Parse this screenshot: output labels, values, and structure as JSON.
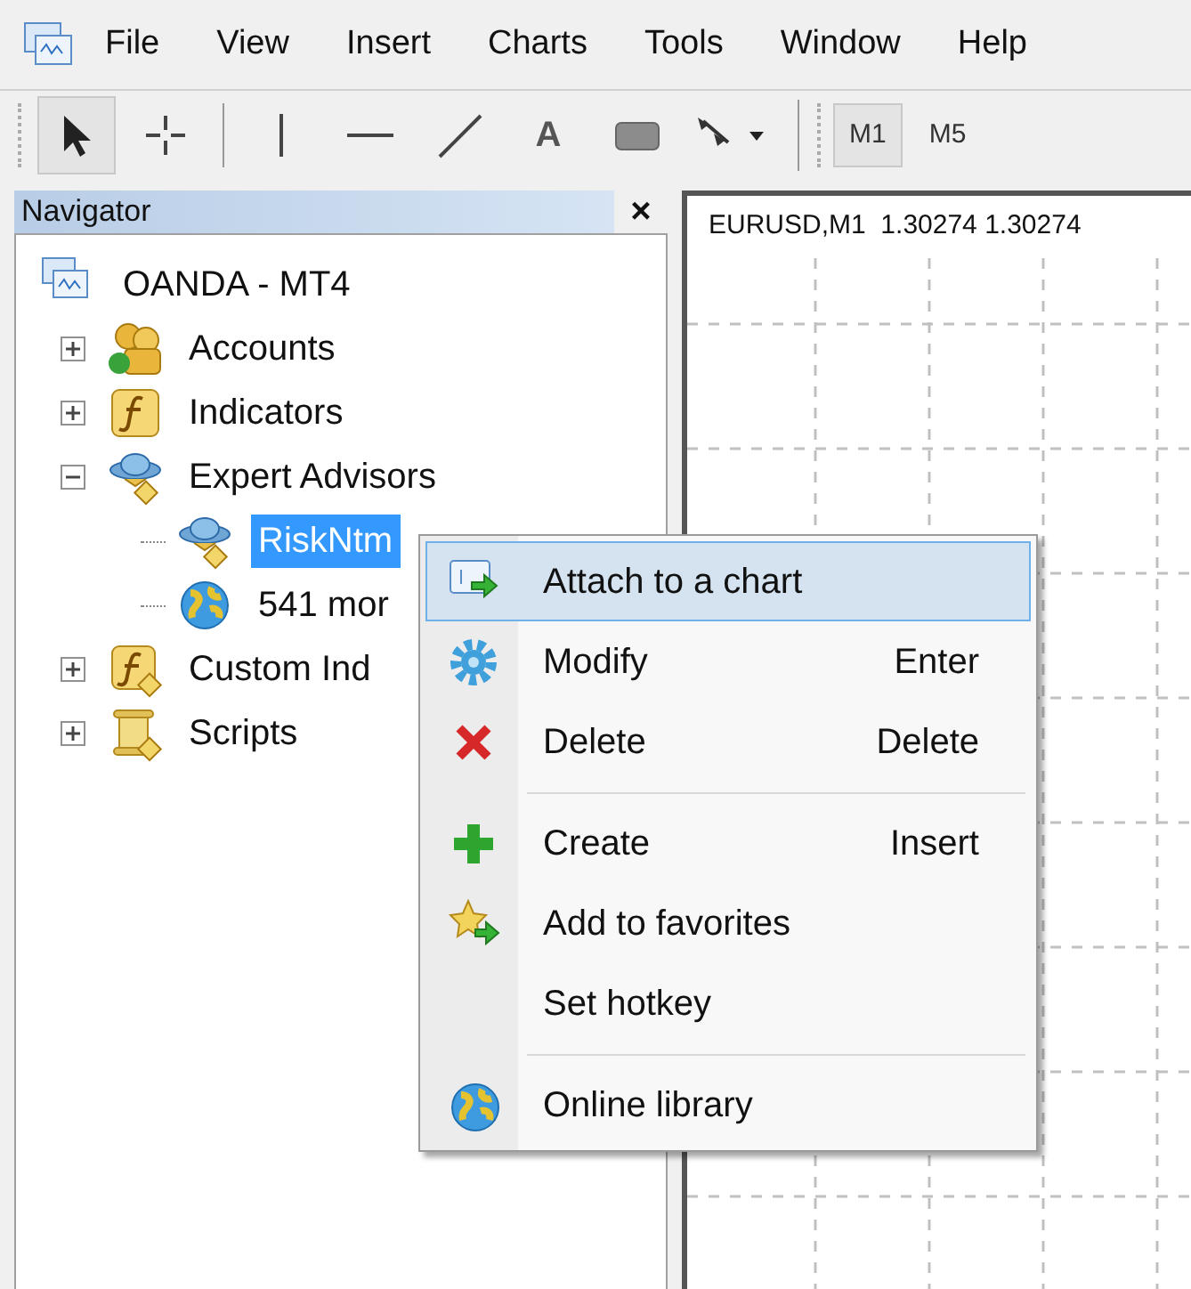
{
  "menu_bar": [
    "File",
    "View",
    "Insert",
    "Charts",
    "Tools",
    "Window",
    "Help"
  ],
  "toolbar": [
    {
      "kind": "cursor",
      "selected": true
    },
    {
      "kind": "crosshair",
      "selected": false
    },
    {
      "kind": "separator"
    },
    {
      "kind": "vline",
      "selected": false
    },
    {
      "kind": "hline",
      "selected": false
    },
    {
      "kind": "trendline",
      "selected": false
    },
    {
      "kind": "text",
      "label": "A",
      "selected": false
    },
    {
      "kind": "rectangle",
      "selected": false
    },
    {
      "kind": "shapes",
      "selected": false
    }
  ],
  "timeframes": [
    {
      "label": "M1",
      "selected": true
    },
    {
      "label": "M5",
      "selected": false
    }
  ],
  "navigator": {
    "title": "Navigator",
    "close": "×",
    "tree": [
      {
        "label": "OANDA - MT4",
        "kind": "terminal",
        "children": [
          {
            "label": "Accounts",
            "kind": "accounts",
            "expanded": false,
            "selected": false
          },
          {
            "label": "Indicators",
            "kind": "indicators",
            "expanded": false,
            "selected": false
          },
          {
            "label": "Expert Advisors",
            "kind": "experts",
            "expanded": true,
            "selected": false,
            "children": [
              {
                "label": "RiskNtm",
                "kind": "experts",
                "selected": true
              },
              {
                "label": "541 mor",
                "kind": "globe",
                "selected": false
              }
            ]
          },
          {
            "label": "Custom Ind",
            "kind": "custom",
            "expanded": false,
            "selected": false
          },
          {
            "label": "Scripts",
            "kind": "scripts",
            "expanded": false,
            "selected": false
          }
        ]
      }
    ]
  },
  "chart": {
    "header": "EURUSD,M1  1.30274 1.30274"
  },
  "context_menu": [
    {
      "kind": "attach",
      "label": "Attach to a chart",
      "selected": true
    },
    {
      "kind": "gear",
      "label": "Modify",
      "shortcut": "Enter",
      "selected": false
    },
    {
      "kind": "cross",
      "label": "Delete",
      "shortcut": "Delete",
      "selected": false
    },
    {
      "kind": "separator"
    },
    {
      "kind": "plus",
      "label": "Create",
      "shortcut": "Insert",
      "selected": false
    },
    {
      "kind": "star",
      "label": "Add to favorites",
      "selected": false
    },
    {
      "kind": "plain",
      "label": "Set hotkey",
      "selected": false
    },
    {
      "kind": "separator"
    },
    {
      "kind": "globe",
      "label": "Online library",
      "selected": false
    }
  ]
}
